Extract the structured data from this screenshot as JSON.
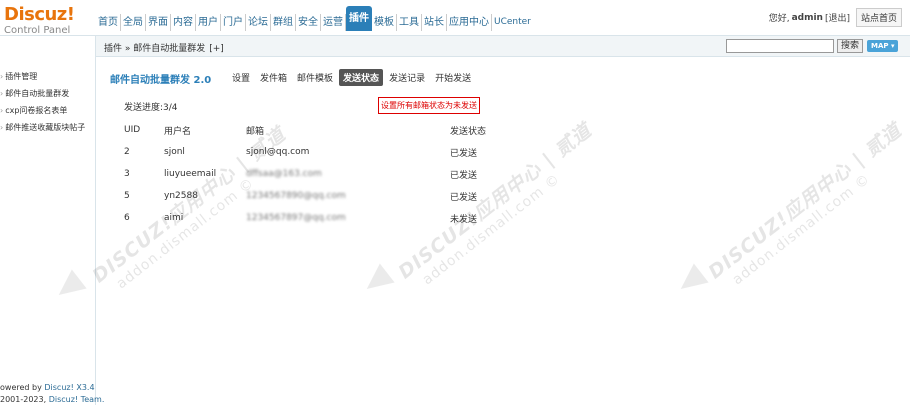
{
  "header": {
    "logo_brand": "Discuz!",
    "logo_sub": "Control Panel",
    "nav": [
      {
        "label": "首页"
      },
      {
        "label": "全局"
      },
      {
        "label": "界面"
      },
      {
        "label": "内容"
      },
      {
        "label": "用户"
      },
      {
        "label": "门户"
      },
      {
        "label": "论坛"
      },
      {
        "label": "群组"
      },
      {
        "label": "安全"
      },
      {
        "label": "运营"
      },
      {
        "label": "插件",
        "active": true
      },
      {
        "label": "模板"
      },
      {
        "label": "工具"
      },
      {
        "label": "站长"
      },
      {
        "label": "应用中心"
      },
      {
        "label": "UCenter"
      }
    ],
    "greeting": "您好,",
    "username": "admin",
    "logout": "[退出]",
    "site_home": "站点首页"
  },
  "subbar": {
    "breadcrumb": "插件 » 邮件自动批量群发",
    "breadcrumb_plus": "[+]",
    "search_value": "",
    "search_button": "搜索",
    "map_button": "MAP ▾"
  },
  "sidebar": {
    "items": [
      {
        "label": "插件管理"
      },
      {
        "label": "邮件自动批量群发"
      },
      {
        "label": "cxp问卷报名表单"
      },
      {
        "label": "邮件推送收藏版块帖子"
      }
    ],
    "footer_line1_prefix": "owered by ",
    "footer_line1_link": "Discuz! X3.4",
    "footer_line2_prefix": " 2001-2023, ",
    "footer_line2_link": "Discuz! Team."
  },
  "main": {
    "plugin_title": "邮件自动批量群发 2.0",
    "tabs": [
      {
        "label": "设置"
      },
      {
        "label": "发件箱"
      },
      {
        "label": "邮件模板"
      },
      {
        "label": "发送状态",
        "active": true
      },
      {
        "label": "发送记录"
      },
      {
        "label": "开始发送"
      }
    ],
    "progress_text": "发送进度:3/4",
    "reset_button": "设置所有邮箱状态为未发送",
    "table": {
      "headers": {
        "uid": "UID",
        "username": "用户名",
        "email": "邮箱",
        "status": "发送状态"
      },
      "rows": [
        {
          "uid": "2",
          "username": "sjonl",
          "email": "sjonl@qq.com",
          "status": "已发送",
          "masked": false
        },
        {
          "uid": "3",
          "username": "liuyueemail",
          "email": "dffsaa@163.com",
          "status": "已发送",
          "masked": true
        },
        {
          "uid": "5",
          "username": "yn2588",
          "email": "1234567890@qq.com",
          "status": "已发送",
          "masked": true
        },
        {
          "uid": "6",
          "username": "aimi",
          "email": "1234567897@qq.com",
          "status": "未发送",
          "masked": true
        }
      ]
    }
  },
  "watermark": {
    "line1": "DISCUZ!应用中心 | 贰道",
    "line2": "addon.dismall.com ©"
  },
  "colors": {
    "accent": "#2b7fb8",
    "logo_orange": "#e8740c",
    "link": "#2b6b95",
    "danger": "#dd0000",
    "active_tab": "#555555"
  }
}
